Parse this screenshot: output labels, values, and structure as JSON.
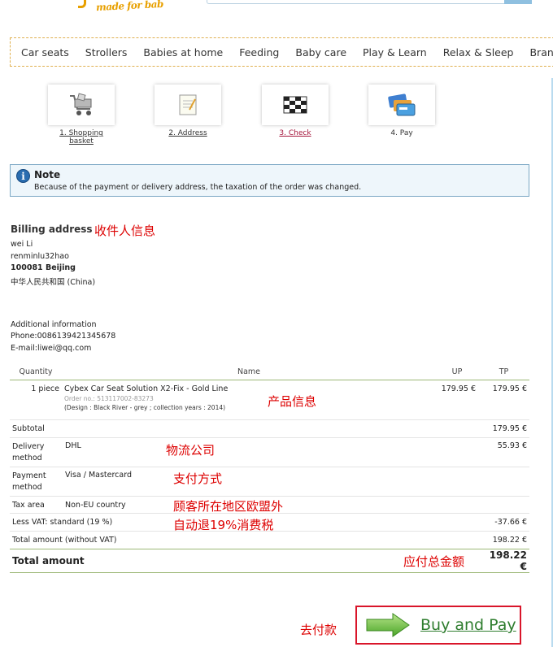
{
  "logo": {
    "tagline": "made for bab"
  },
  "nav": [
    "Car seats",
    "Strollers",
    "Babies at home",
    "Feeding",
    "Baby care",
    "Play & Learn",
    "Relax & Sleep",
    "Brand s"
  ],
  "steps": [
    {
      "number_label": "1. Shopping",
      "label_line2": "basket",
      "icon": "shopping-cart-icon"
    },
    {
      "number_label": "2. Address",
      "icon": "notepad-icon"
    },
    {
      "number_label": "3. Check",
      "icon": "checkered-flag-icon"
    },
    {
      "number_label": "4. Pay",
      "icon": "credit-cards-icon"
    }
  ],
  "note": {
    "icon": "info-icon",
    "title": "Note",
    "text": "Because of the payment or delivery address, the taxation of the order was changed."
  },
  "billing": {
    "title": "Billing address",
    "name": "wei Li",
    "street": "renminlu32hao",
    "city": "100081 Beijing",
    "country": "中华人民共和国 (China)",
    "additional_title": "Additional information",
    "phone": "Phone:008613942134567​8",
    "email": "E-mail:liwei@qq.com"
  },
  "table": {
    "headers": {
      "quantity": "Quantity",
      "name": "Name",
      "up": "UP",
      "tp": "TP"
    },
    "item": {
      "qty": "1 piece",
      "title": "Cybex Car Seat Solution X2-Fix - Gold Line",
      "order_no": "Order no.: 513117002-83273",
      "details": "(Design : Black River - grey ; collection years : 2014)",
      "up": "179.95 €",
      "tp": "179.95 €"
    },
    "subtotal": {
      "label": "Subtotal",
      "value": "179.95 €"
    },
    "delivery": {
      "label": "Delivery method",
      "name": "DHL",
      "value": "55.93 €"
    },
    "payment": {
      "label": "Payment method",
      "name": "Visa / Mastercard"
    },
    "tax_area": {
      "label": "Tax area",
      "name": "Non-EU country"
    },
    "less_vat": {
      "label": "Less VAT: standard (19 %)",
      "value": "-37.66 €"
    },
    "total_without_vat": {
      "label": "Total amount (without VAT)",
      "value": "198.22 €"
    },
    "total": {
      "label": "Total amount",
      "value": "198.22 €"
    }
  },
  "annotations": {
    "recipient": "收件人信息",
    "product": "产品信息",
    "logistics": "物流公司",
    "payment": "支付方式",
    "region": "顾客所在地区欧盟外",
    "vat": "自动退19%消费税",
    "total": "应付总金额",
    "pay": "去付款"
  },
  "buy": {
    "label": "Buy and Pay",
    "icon": "green-arrow-icon"
  },
  "colors": {
    "accent_green": "#2e7d2e",
    "annotation_red": "#dd0000",
    "active_step": "#a4143a",
    "note_border": "#7aa7c4"
  }
}
